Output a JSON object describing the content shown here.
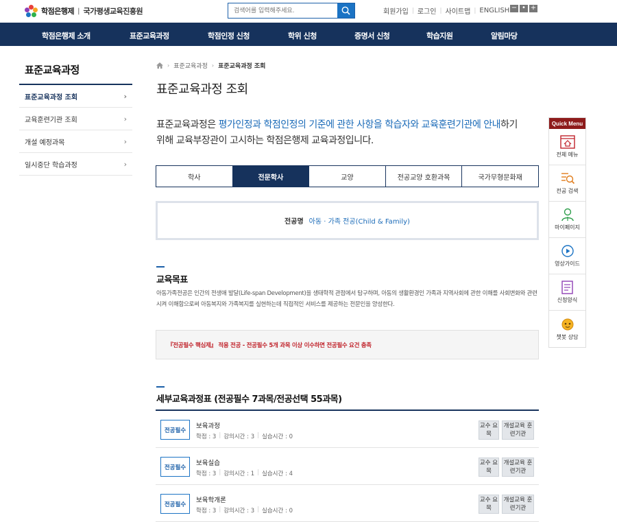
{
  "header": {
    "logo_text": "학점은행제",
    "logo_sep": "|",
    "org_name": "국가평생교육진흥원",
    "search_placeholder": "검색어를 입력해주세요.",
    "util_links": [
      "회원가입",
      "로그인",
      "사이트맵",
      "ENGLISH"
    ],
    "zoom_controls": [
      "−",
      "•",
      "+"
    ]
  },
  "gnb": [
    "학점은행제 소개",
    "표준교육과정",
    "학점인정 신청",
    "학위 신청",
    "증명서 신청",
    "학습지원",
    "알림마당"
  ],
  "sidebar": {
    "title": "표준교육과정",
    "items": [
      {
        "label": "표준교육과정 조회",
        "active": true
      },
      {
        "label": "교육훈련기관 조회",
        "active": false
      },
      {
        "label": "개설 예정과목",
        "active": false
      },
      {
        "label": "일시중단 학습과정",
        "active": false
      }
    ]
  },
  "breadcrumb": {
    "items": [
      "표준교육과정",
      "표준교육과정 조회"
    ]
  },
  "page_title": "표준교육과정 조회",
  "intro": {
    "p1": "표준교육과정은 ",
    "hl": "평가인정과 학점인정의 기준에 관한 사항을 학습자와 교육훈련기관에 안내",
    "p2": "하기 위해 교육부장관이 고시하는 학점은행제 교육과정입니다."
  },
  "tabs": [
    {
      "label": "학사",
      "active": false
    },
    {
      "label": "전문학사",
      "active": true
    },
    {
      "label": "교양",
      "active": false
    },
    {
      "label": "전공교양 호환과목",
      "active": false
    },
    {
      "label": "국가무형문화재",
      "active": false
    }
  ],
  "major": {
    "label": "전공명",
    "value": "아동 · 가족 전공(Child & Family)"
  },
  "goal": {
    "title": "교육목표",
    "text": "아동가족전공은 인간의 전생애 발달(Life-span Development)을 생태학적 관점에서 탐구하며, 아동의 생활환경인 가족과 지역사회에 관한 이해를 사회변화와 관련시켜 이해함으로써 아동복지와 가족복지를 실현하는데 직접적인 서비스를 제공하는 전문인을 양성한다."
  },
  "notice": "『전공필수 핵심제』 적용 전공 - 전공필수 5개 과목 이상 이수하면 전공필수 요건 충족",
  "course_table": {
    "title": "세부교육과정표 (전공필수 7과목/전공선택 55과목)",
    "btn_prof": "교수 요목",
    "btn_inst": "개설교육 훈련기관",
    "courses": [
      {
        "badge": "전공필수",
        "name": "보육과정",
        "credit": "학점 : 3",
        "lecture": "강의시간 : 3",
        "practice": "실습시간 : 0"
      },
      {
        "badge": "전공필수",
        "name": "보육실습",
        "credit": "학점 : 3",
        "lecture": "강의시간 : 1",
        "practice": "실습시간 : 4"
      },
      {
        "badge": "전공필수",
        "name": "보육학개론",
        "credit": "학점 : 3",
        "lecture": "강의시간 : 3",
        "practice": "실습시간 : 0"
      }
    ]
  },
  "quick_menu": {
    "title": "Quick Menu",
    "items": [
      {
        "label": "전체 메뉴",
        "icon": "all-menu-icon"
      },
      {
        "label": "전공 검색",
        "icon": "major-search-icon"
      },
      {
        "label": "마이페이지",
        "icon": "mypage-icon"
      },
      {
        "label": "영상가이드",
        "icon": "video-guide-icon"
      },
      {
        "label": "신청양식",
        "icon": "form-icon"
      },
      {
        "label": "챗봇 상담",
        "icon": "chatbot-icon"
      }
    ]
  },
  "colors": {
    "navy": "#16325c",
    "accent": "#1b6bb8",
    "notice_red": "#c0222a",
    "quick_head": "#8e1b1b"
  }
}
